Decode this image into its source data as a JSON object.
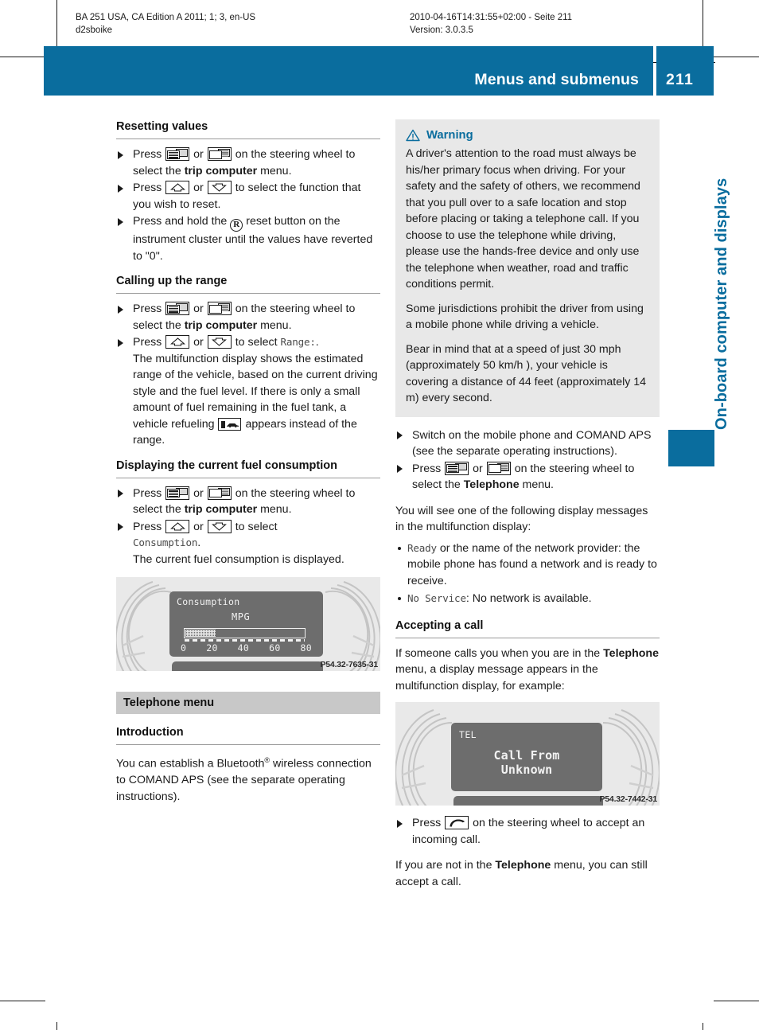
{
  "print_header": {
    "line1": "BA 251 USA, CA Edition A 2011; 1; 3, en-US",
    "line2": "d2sboike",
    "line3": "2010-04-16T14:31:55+02:00 - Seite 211",
    "line4": "Version: 3.0.3.5"
  },
  "titlebar": {
    "title": "Menus and submenus",
    "page_number": "211",
    "accent_color": "#0a6d9e"
  },
  "side_tab": {
    "label": "On-board computer and displays"
  },
  "left_column": {
    "s1": {
      "heading": "Resetting values",
      "step1_a": "Press",
      "step1_or": "or",
      "step1_b": "on the steering wheel to select the",
      "step1_bold": "trip computer",
      "step1_c": "menu.",
      "step2_a": "Press",
      "step2_or": "or",
      "step2_b": "to select the function that you wish to reset.",
      "step3_a": "Press and hold the",
      "step3_b": "reset button on the instrument cluster until the values have reverted to \"0\"."
    },
    "s2": {
      "heading": "Calling up the range",
      "step1_a": "Press",
      "step1_or": "or",
      "step1_b": "on the steering wheel to select the",
      "step1_bold": "trip computer",
      "step1_c": "menu.",
      "step2_a": "Press",
      "step2_or": "or",
      "step2_b": "to select",
      "step2_code": "Range:",
      "step2_c": ".",
      "step2_cont_a": "The multifunction display shows the estimated range of the vehicle, based on the current driving style and the fuel level. If there is only a small amount of fuel remaining in the fuel tank, a vehicle refueling",
      "step2_cont_b": "appears instead of the range."
    },
    "s3": {
      "heading": "Displaying the current fuel consumption",
      "step1_a": "Press",
      "step1_or": "or",
      "step1_b": "on the steering wheel to select the",
      "step1_bold": "trip computer",
      "step1_c": "menu.",
      "step2_a": "Press",
      "step2_or": "or",
      "step2_b": "to select",
      "step2_code": "Consumption",
      "step2_c": ".",
      "step2_cont": "The current fuel consumption is displayed."
    },
    "figure1": {
      "lcd_title": "Consumption",
      "lcd_unit": "MPG",
      "scale": [
        "0",
        "20",
        "40",
        "60",
        "80"
      ],
      "code": "P54.32-7635-31"
    },
    "band": "Telephone menu",
    "s4": {
      "heading": "Introduction",
      "para_a": "You can establish a Bluetooth",
      "para_sup": "®",
      "para_b": " wireless connection to COMAND APS (see the separate operating instructions)."
    }
  },
  "right_column": {
    "warning": {
      "label": "Warning",
      "icon": "warning-triangle-icon",
      "p1": "A driver's attention to the road must always be his/her primary focus when driving. For your safety and the safety of others, we recommend that you pull over to a safe location and stop before placing or taking a telephone call. If you choose to use the telephone while driving, please use the hands-free device and only use the telephone when weather, road and traffic conditions permit.",
      "p2": "Some jurisdictions prohibit the driver from using a mobile phone while driving a vehicle.",
      "p3": "Bear in mind that at a speed of just 30 mph (approximately 50 km/h ), your vehicle is covering a distance of 44 feet (approximately 14 m) every second."
    },
    "step1": "Switch on the mobile phone and COMAND APS (see the separate operating instructions).",
    "step2_a": "Press",
    "step2_or": "or",
    "step2_b": "on the steering wheel to select the",
    "step2_bold": "Telephone",
    "step2_c": "menu.",
    "para1": "You will see one of the following display messages in the multifunction display:",
    "bullet1_code": "Ready",
    "bullet1_text": " or the name of the network provider: the mobile phone has found a network and is ready to receive.",
    "bullet2_code": "No Service",
    "bullet2_text": ": No network is available.",
    "s5": {
      "heading": "Accepting a call",
      "para_a": "If someone calls you when you are in the",
      "para_bold": "Telephone",
      "para_b": "menu, a display message appears in the multifunction display, for example:"
    },
    "figure2": {
      "lcd_label": "TEL",
      "lcd_line1": "Call From",
      "lcd_line2": "Unknown",
      "code": "P54.32-7442-31"
    },
    "step3_a": "Press",
    "step3_b": "on the steering wheel to accept an incoming call.",
    "para2_a": "If you are not in the",
    "para2_bold": "Telephone",
    "para2_b": "menu, you can still accept a call."
  }
}
